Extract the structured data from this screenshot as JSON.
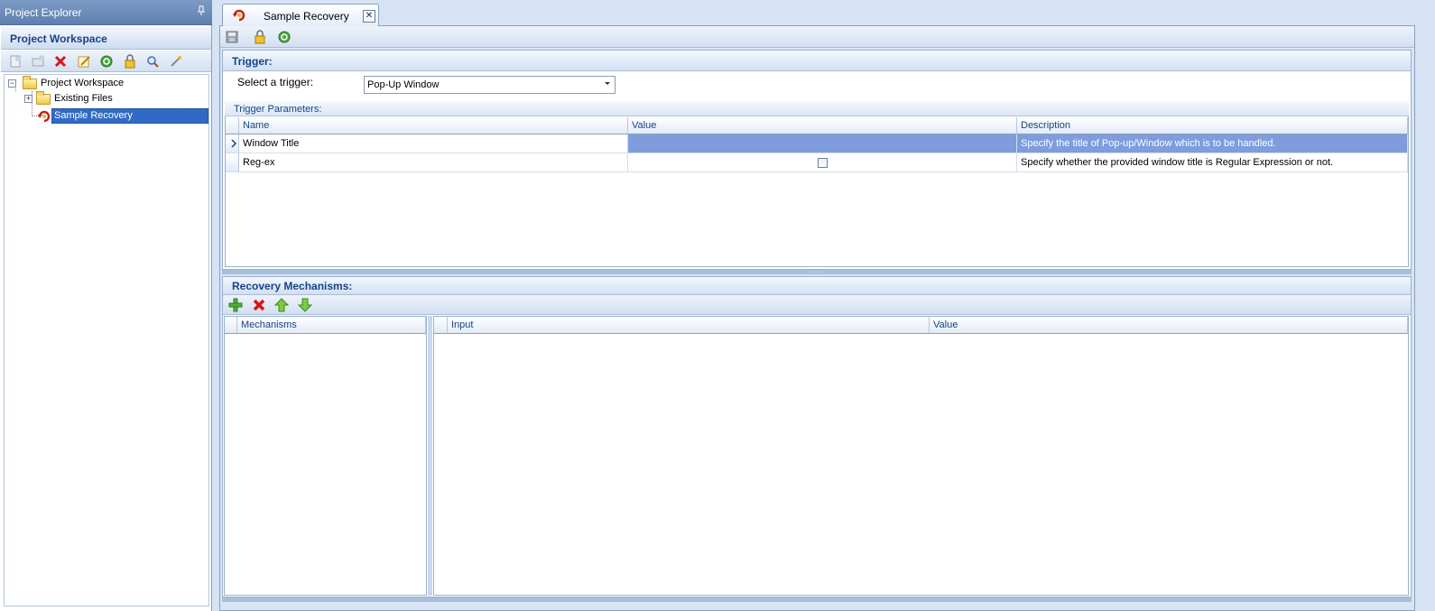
{
  "explorer": {
    "title": "Project Explorer",
    "pin_icon": "pin-icon",
    "workspace_header": "Project Workspace",
    "toolbar_icons": [
      "add-file-icon",
      "add-folder-icon",
      "delete-icon",
      "edit-icon",
      "refresh-icon",
      "lock-icon",
      "search-icon",
      "properties-icon"
    ],
    "tree": {
      "root": "Project Workspace",
      "children": [
        "Existing Files",
        "Sample Recovery"
      ]
    }
  },
  "document": {
    "tab_label": "Sample Recovery",
    "toolbar_icons": [
      "save-icon",
      "lock-icon",
      "refresh-icon"
    ]
  },
  "trigger": {
    "section_title": "Trigger:",
    "select_label": "Select a trigger:",
    "select_value": "Pop-Up Window",
    "params_caption": "Trigger Parameters:",
    "columns": [
      "Name",
      "Value",
      "Description"
    ],
    "rows": [
      {
        "name": "Window Title",
        "value": "",
        "description": "Specify the title of Pop-up/Window which is to be handled."
      },
      {
        "name": "Reg-ex",
        "value": "",
        "description": "Specify whether the provided window title is Regular Expression or not."
      }
    ]
  },
  "recovery": {
    "section_title": "Recovery Mechanisms:",
    "toolbar_icons": [
      "add-icon",
      "remove-icon",
      "move-up-icon",
      "move-down-icon"
    ],
    "mechanisms_header": "Mechanisms",
    "input_columns": [
      "Input",
      "Value"
    ]
  },
  "colors": {
    "selection": "#316ac5",
    "header_text": "#15428b",
    "row_selected": "#7f9cdd"
  }
}
